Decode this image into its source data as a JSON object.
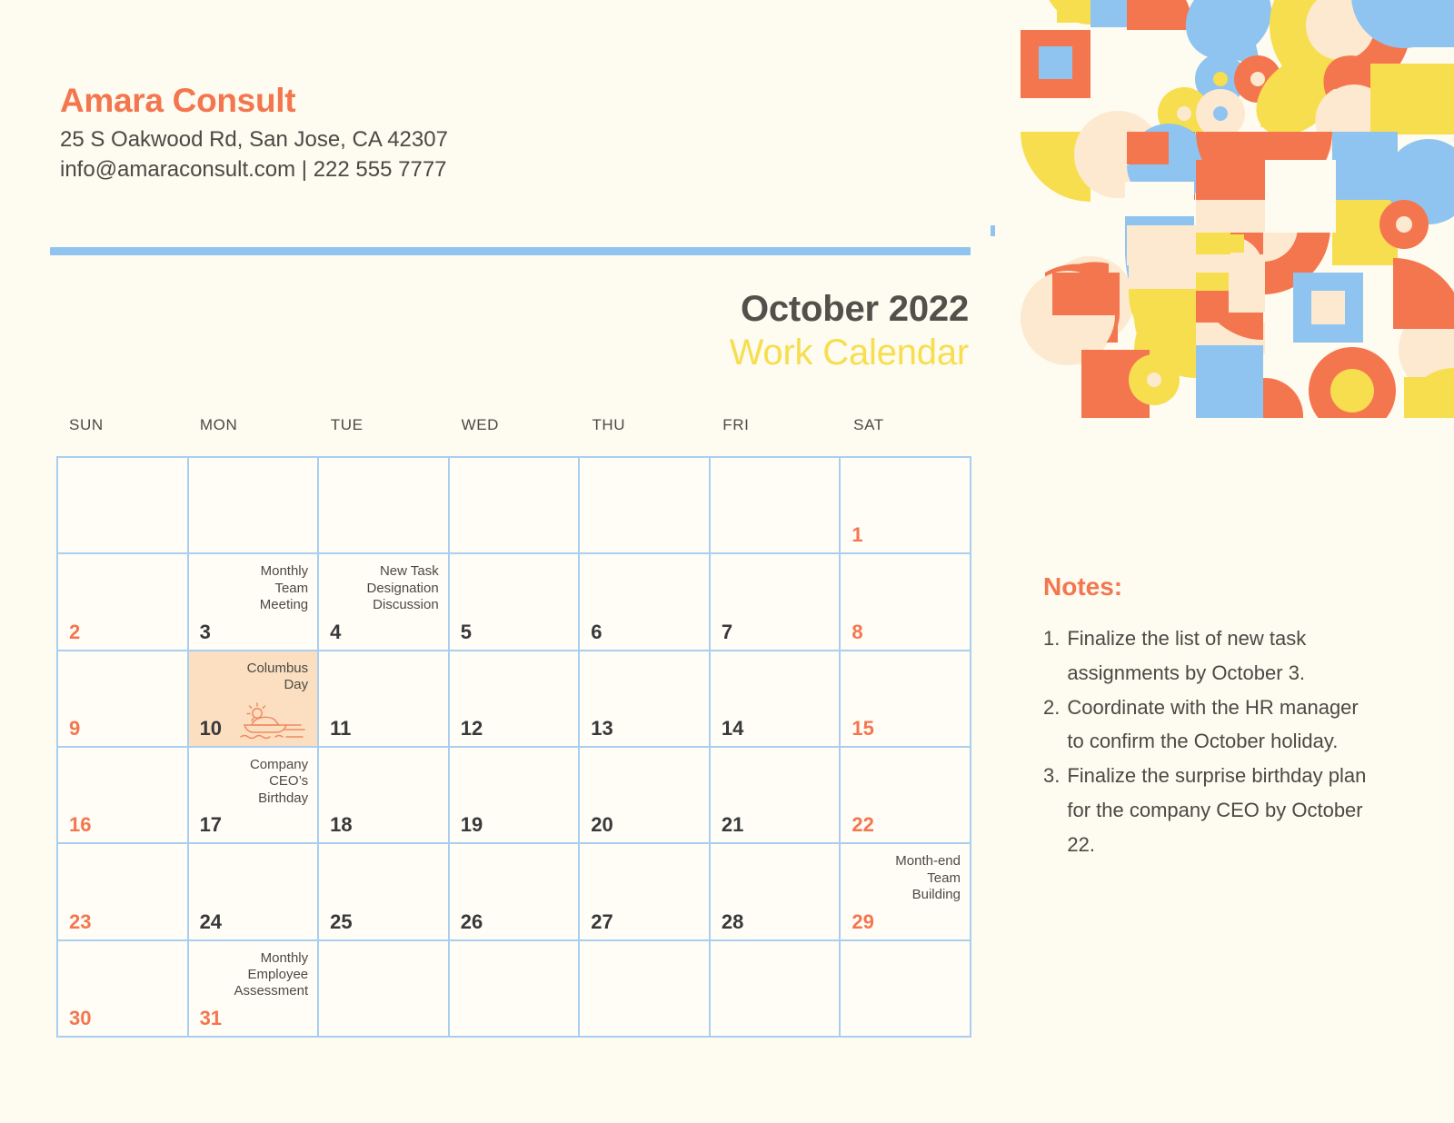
{
  "company": {
    "name": "Amara Consult",
    "address": "25 S Oakwood Rd, San Jose, CA 42307",
    "contact": "info@amaraconsult.com | 222 555 7777"
  },
  "title": {
    "month_year": "October 2022",
    "subtitle": "Work Calendar"
  },
  "colors": {
    "background": "#FEFBF0",
    "accent_orange": "#F4764F",
    "accent_yellow": "#F7DE4F",
    "accent_blue": "#8FC4F0",
    "grid_line": "#A9CFF0",
    "highlight_cell": "#FCDFC0",
    "text_dark": "#4A4A45",
    "cream": "#FCE9D0"
  },
  "weekdays": [
    "SUN",
    "MON",
    "TUE",
    "WED",
    "THU",
    "FRI",
    "SAT"
  ],
  "calendar": {
    "cells": [
      {
        "day": "",
        "event": "",
        "weekend": false,
        "highlight": false,
        "illo": false
      },
      {
        "day": "",
        "event": "",
        "weekend": false,
        "highlight": false,
        "illo": false
      },
      {
        "day": "",
        "event": "",
        "weekend": false,
        "highlight": false,
        "illo": false
      },
      {
        "day": "",
        "event": "",
        "weekend": false,
        "highlight": false,
        "illo": false
      },
      {
        "day": "",
        "event": "",
        "weekend": false,
        "highlight": false,
        "illo": false
      },
      {
        "day": "",
        "event": "",
        "weekend": false,
        "highlight": false,
        "illo": false
      },
      {
        "day": "1",
        "event": "",
        "weekend": true,
        "highlight": false,
        "illo": false
      },
      {
        "day": "2",
        "event": "",
        "weekend": true,
        "highlight": false,
        "illo": false
      },
      {
        "day": "3",
        "event": "Monthly Team Meeting",
        "weekend": false,
        "highlight": false,
        "illo": false
      },
      {
        "day": "4",
        "event": "New Task Designation Discussion",
        "weekend": false,
        "highlight": false,
        "illo": false
      },
      {
        "day": "5",
        "event": "",
        "weekend": false,
        "highlight": false,
        "illo": false
      },
      {
        "day": "6",
        "event": "",
        "weekend": false,
        "highlight": false,
        "illo": false
      },
      {
        "day": "7",
        "event": "",
        "weekend": false,
        "highlight": false,
        "illo": false
      },
      {
        "day": "8",
        "event": "",
        "weekend": true,
        "highlight": false,
        "illo": false
      },
      {
        "day": "9",
        "event": "",
        "weekend": true,
        "highlight": false,
        "illo": false
      },
      {
        "day": "10",
        "event": "Columbus Day",
        "weekend": false,
        "highlight": true,
        "illo": true
      },
      {
        "day": "11",
        "event": "",
        "weekend": false,
        "highlight": false,
        "illo": false
      },
      {
        "day": "12",
        "event": "",
        "weekend": false,
        "highlight": false,
        "illo": false
      },
      {
        "day": "13",
        "event": "",
        "weekend": false,
        "highlight": false,
        "illo": false
      },
      {
        "day": "14",
        "event": "",
        "weekend": false,
        "highlight": false,
        "illo": false
      },
      {
        "day": "15",
        "event": "",
        "weekend": true,
        "highlight": false,
        "illo": false
      },
      {
        "day": "16",
        "event": "",
        "weekend": true,
        "highlight": false,
        "illo": false
      },
      {
        "day": "17",
        "event": "Company CEO’s Birthday",
        "weekend": false,
        "highlight": false,
        "illo": false
      },
      {
        "day": "18",
        "event": "",
        "weekend": false,
        "highlight": false,
        "illo": false
      },
      {
        "day": "19",
        "event": "",
        "weekend": false,
        "highlight": false,
        "illo": false
      },
      {
        "day": "20",
        "event": "",
        "weekend": false,
        "highlight": false,
        "illo": false
      },
      {
        "day": "21",
        "event": "",
        "weekend": false,
        "highlight": false,
        "illo": false
      },
      {
        "day": "22",
        "event": "",
        "weekend": true,
        "highlight": false,
        "illo": false
      },
      {
        "day": "23",
        "event": "",
        "weekend": true,
        "highlight": false,
        "illo": false
      },
      {
        "day": "24",
        "event": "",
        "weekend": false,
        "highlight": false,
        "illo": false
      },
      {
        "day": "25",
        "event": "",
        "weekend": false,
        "highlight": false,
        "illo": false
      },
      {
        "day": "26",
        "event": "",
        "weekend": false,
        "highlight": false,
        "illo": false
      },
      {
        "day": "27",
        "event": "",
        "weekend": false,
        "highlight": false,
        "illo": false
      },
      {
        "day": "28",
        "event": "",
        "weekend": false,
        "highlight": false,
        "illo": false
      },
      {
        "day": "29",
        "event": "Month-end Team Building",
        "weekend": true,
        "highlight": false,
        "illo": false
      },
      {
        "day": "30",
        "event": "",
        "weekend": true,
        "highlight": false,
        "illo": false
      },
      {
        "day": "31",
        "event": "Monthly Employee Assessment",
        "weekend": true,
        "highlight": false,
        "illo": false
      },
      {
        "day": "",
        "event": "",
        "weekend": false,
        "highlight": false,
        "illo": false
      },
      {
        "day": "",
        "event": "",
        "weekend": false,
        "highlight": false,
        "illo": false
      },
      {
        "day": "",
        "event": "",
        "weekend": false,
        "highlight": false,
        "illo": false
      },
      {
        "day": "",
        "event": "",
        "weekend": false,
        "highlight": false,
        "illo": false
      },
      {
        "day": "",
        "event": "",
        "weekend": false,
        "highlight": false,
        "illo": false
      }
    ]
  },
  "notes": {
    "title": "Notes:",
    "items": [
      {
        "num": "1.",
        "text": "Finalize the list of new task assignments by October 3."
      },
      {
        "num": "2.",
        "text": "Coordinate with the HR manager to confirm the October holiday."
      },
      {
        "num": "3.",
        "text": "Finalize the surprise birthday plan for the company CEO by October 22."
      }
    ]
  },
  "decoration": {
    "pattern_name": "geometric-shapes-pattern",
    "illustration_name": "ship-with-sun-illustration"
  }
}
